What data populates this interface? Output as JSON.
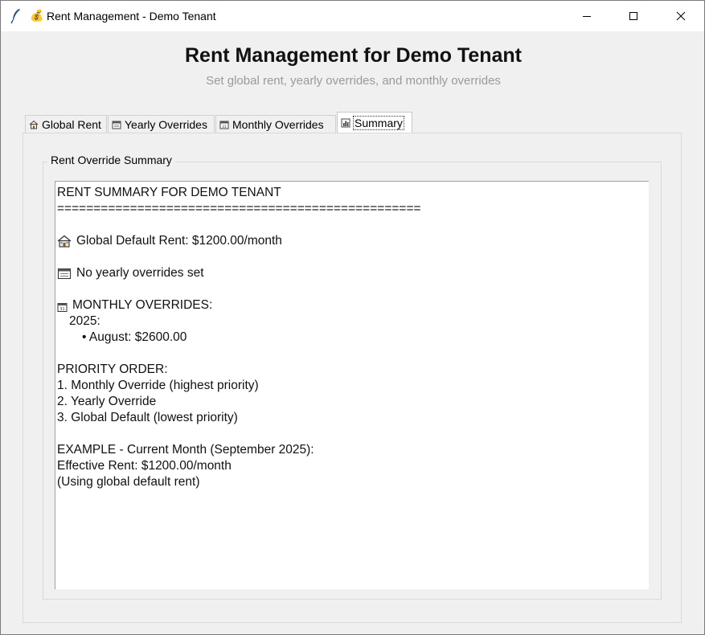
{
  "window": {
    "title": "Rent Management - Demo Tenant",
    "app_icon": "feather-icon",
    "title_icon": "money-bag-icon"
  },
  "header": {
    "title": "Rent Management for Demo Tenant",
    "subtitle": "Set global rent, yearly overrides, and monthly overrides"
  },
  "tabs": [
    {
      "label": "Global Rent",
      "icon": "house-icon"
    },
    {
      "label": "Yearly Overrides",
      "icon": "calendar-icon"
    },
    {
      "label": "Monthly Overrides",
      "icon": "date-calendar-icon"
    },
    {
      "label": "Summary",
      "icon": "bar-chart-icon",
      "active": true
    }
  ],
  "summary": {
    "group_title": "Rent Override Summary",
    "lines": {
      "heading": "RENT SUMMARY FOR DEMO TENANT",
      "separator": "==================================================",
      "global": "Global Default Rent: $1200.00/month",
      "yearly": "No yearly overrides set",
      "monthly_header": "MONTHLY OVERRIDES:",
      "monthly_year": "2025:",
      "monthly_item": "• August: $2600.00",
      "priority_header": "PRIORITY ORDER:",
      "priority_1": "1. Monthly Override (highest priority)",
      "priority_2": "2. Yearly Override",
      "priority_3": "3. Global Default (lowest priority)",
      "example_header": "EXAMPLE - Current Month (September 2025):",
      "effective": "Effective Rent: $1200.00/month",
      "using": "(Using global default rent)"
    }
  }
}
